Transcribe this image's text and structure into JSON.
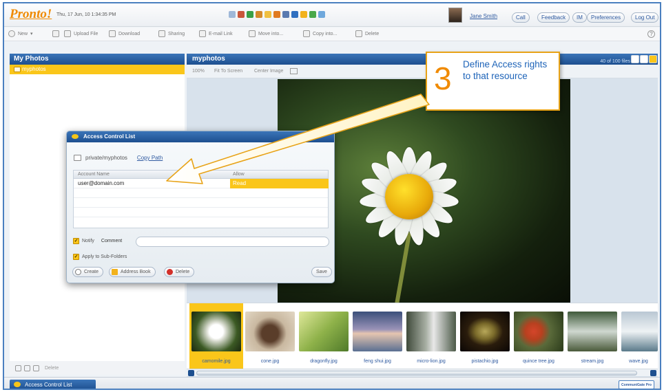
{
  "header": {
    "logo": "Pronto!",
    "datetime": "Thu, 17 Jun, 10 1:34:35 PM",
    "user_name": "Jane Smith",
    "buttons": [
      "Call",
      "Feedback",
      "IM",
      "Preferences",
      "Log Out"
    ]
  },
  "toolbar": {
    "items": [
      "New",
      "Upload File",
      "Download",
      "Sharing",
      "E-mail Link",
      "Move into...",
      "Copy into...",
      "Delete"
    ]
  },
  "left_panel": {
    "title": "My Photos",
    "folder": "myphotos",
    "bottom_delete": "Delete"
  },
  "right_panel": {
    "title": "myphotos",
    "file_count": "40 of 100 files",
    "zoom": [
      "100%",
      "Fit To Screen",
      "Center Image"
    ]
  },
  "thumbnails": [
    {
      "name": "camomile.jpg",
      "color": "#3c5a24"
    },
    {
      "name": "cone.jpg",
      "color": "#b08a6a"
    },
    {
      "name": "dragonfly.jpg",
      "color": "#8fb24a"
    },
    {
      "name": "feng shui.jpg",
      "color": "#9a93b8"
    },
    {
      "name": "micro-lion.jpg",
      "color": "#7c8a7a"
    },
    {
      "name": "pistachio.jpg",
      "color": "#4f3a1c"
    },
    {
      "name": "quince tree.jpg",
      "color": "#8a4a2a"
    },
    {
      "name": "stream.jpg",
      "color": "#6a7d5a"
    },
    {
      "name": "wave.jpg",
      "color": "#b9c7d3"
    }
  ],
  "acl": {
    "title": "Access Control List",
    "path": "private/myphotos",
    "copy_path": "Copy Path",
    "col_account": "Account Name",
    "col_allow": "Allow",
    "row_account": "user@domain.com",
    "row_perm": "Read",
    "notify": "Notify",
    "comment": "Comment",
    "apply_sub": "Apply to Sub-Folders",
    "btn_create": "Create",
    "btn_address": "Address Book",
    "btn_delete": "Delete",
    "btn_save": "Save"
  },
  "callout": {
    "number": "3",
    "text": "Define Access rights to that resource"
  },
  "footer": {
    "tab": "Access Control List",
    "brand": "CommuniGate Pro"
  },
  "colors": {
    "accent": "#fac61a",
    "blue": "#1d4f8f",
    "callout_text": "#1d63b8",
    "callout_border": "#e8a317"
  }
}
